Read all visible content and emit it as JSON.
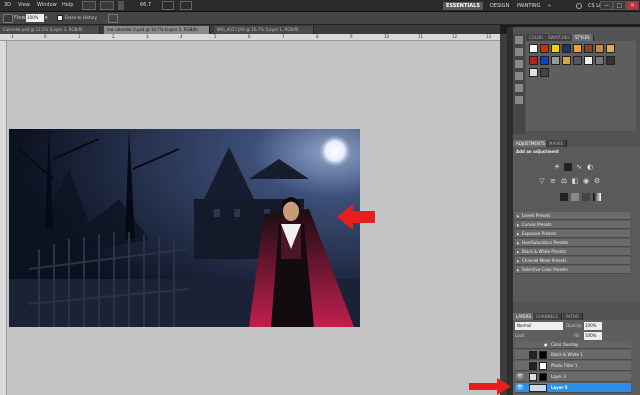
{
  "menubar": {
    "items": [
      "3D",
      "View",
      "Window",
      "Help"
    ],
    "zoom": "66.7",
    "workspaces": {
      "essentials": "ESSENTIALS",
      "design": "DESIGN",
      "painting": "PAINTING",
      "more": "»"
    },
    "cslive": "CS Live",
    "window_controls": [
      "−",
      "□",
      "✕"
    ]
  },
  "options": {
    "flow_label": "Flow:",
    "flow_value": "100%",
    "erase_history": "Erase to History"
  },
  "tabs": [
    "Calender.psd @ 12.5% (Layer 3, RGB/8)",
    "me calender 2.psd @ 16.7% (Layer 5, RGB/8)",
    "IMG_4027.JPG @ 16.7% (Layer 1, RGB/8)"
  ],
  "ruler": [
    "-1",
    "0",
    "1",
    "2",
    "3",
    "4",
    "5",
    "6",
    "7",
    "8",
    "9",
    "10",
    "11",
    "12",
    "13"
  ],
  "panels": {
    "tabs_top": [
      "COLOR",
      "SWATCHES",
      "STYLES"
    ],
    "adjust_tabs": [
      "ADJUSTMENTS",
      "MASKS"
    ],
    "adjust_title": "Add an adjustment",
    "presets": [
      "Levels Presets",
      "Curves Presets",
      "Exposure Presets",
      "Hue/Saturation Presets",
      "Black & White Presets",
      "Channel Mixer Presets",
      "Selective Color Presets"
    ],
    "layers_tabs": [
      "LAYERS",
      "CHANNELS",
      "PATHS"
    ],
    "blend_mode": "Normal",
    "opacity_label": "Opacity:",
    "opacity_value": "100%",
    "lock_label": "Lock:",
    "fill_label": "Fill:",
    "fill_value": "100%",
    "layers": [
      {
        "name": "Color Overlay"
      },
      {
        "name": "Black & White 1"
      },
      {
        "name": "Photo Filter 1"
      },
      {
        "name": "Layer 3"
      },
      {
        "name": "Layer 5",
        "selected": true
      }
    ]
  },
  "colors": {
    "accent": "#2b8fe8",
    "arrow": "#e81e1e",
    "canvas_bg": "#c4c4c4"
  }
}
